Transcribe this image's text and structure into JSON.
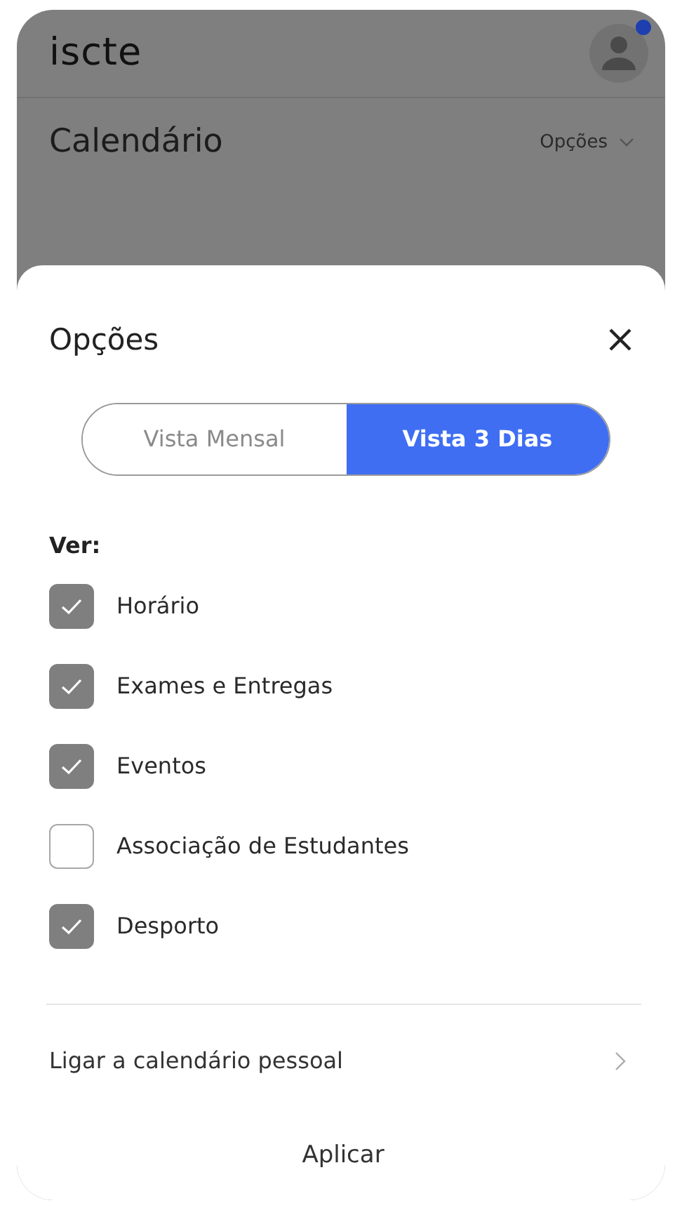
{
  "header": {
    "logo": "iscte",
    "avatar_notification": true
  },
  "page": {
    "title": "Calendário",
    "options_label": "Opções"
  },
  "sheet": {
    "title": "Opções",
    "view_tabs": [
      {
        "label": "Vista Mensal",
        "selected": false
      },
      {
        "label": "Vista 3 Dias",
        "selected": true
      }
    ],
    "filter_heading": "Ver:",
    "filters": [
      {
        "label": "Horário",
        "checked": true
      },
      {
        "label": "Exames e Entregas",
        "checked": true
      },
      {
        "label": "Eventos",
        "checked": true
      },
      {
        "label": "Associação de Estudantes",
        "checked": false
      },
      {
        "label": "Desporto",
        "checked": true
      }
    ],
    "link_label": "Ligar a calendário pessoal",
    "apply_label": "Aplicar"
  }
}
